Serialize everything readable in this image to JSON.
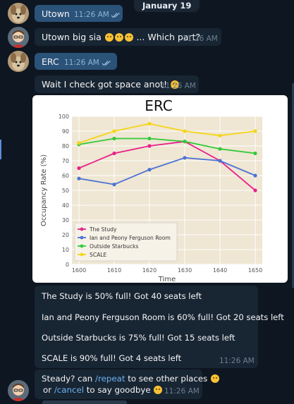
{
  "date_pill": "January 19",
  "messages": [
    {
      "text": "Utown",
      "time": "11:26 AM"
    },
    {
      "text": "Utown big sia",
      "text_after": "... Which part?",
      "time": "11:26 AM"
    },
    {
      "text": "ERC",
      "time": "11:26 AM"
    },
    {
      "text": "Wait I check got space anot!",
      "time": "11:26 AM"
    },
    {
      "lines": [
        "The Study is 50% full!  Got 40 seats left",
        "Ian and Peony Ferguson Room is 60% full!  Got 20 seats left",
        "Outside Starbucks is 75% full!  Got 15 seats left",
        "SCALE is 90% full!  Got 4 seats left"
      ],
      "time": "11:26 AM"
    },
    {
      "line1_a": "Steady? can ",
      "line1_link": "/repeat",
      "line1_b": " to see other places",
      "line2_a": "or ",
      "line2_link": "/cancel",
      "line2_b": " to say goodbye",
      "time": "11:26 AM"
    }
  ],
  "icons": {
    "avatar_user": "dog-avatar-icon",
    "avatar_bot": "bot-avatar-icon",
    "read": "double-check-icon",
    "emoji": "emoji-icon"
  },
  "colors": {
    "bg": "#0e1621",
    "outgoing": "#2b5278",
    "incoming": "#182533",
    "link": "#6ab3f3"
  },
  "chart_data": {
    "type": "line",
    "title": "ERC",
    "xlabel": "Time",
    "ylabel": "Occupancy Rate (%)",
    "x": [
      1600,
      1610,
      1620,
      1630,
      1640,
      1650
    ],
    "xticks": [
      "1600",
      "1610",
      "1620",
      "1630",
      "1640",
      "1650"
    ],
    "yticks": [
      "0",
      "10",
      "20",
      "30",
      "40",
      "50",
      "60",
      "70",
      "80",
      "90",
      "100"
    ],
    "ylim": [
      0,
      100
    ],
    "grid": true,
    "legend": "lower-left",
    "series": [
      {
        "name": "The Study",
        "color": "#e8218a",
        "values": [
          65,
          75,
          80,
          83,
          70,
          50
        ]
      },
      {
        "name": "Ian and Peony Ferguson Room",
        "color": "#4c72d4",
        "values": [
          58,
          54,
          64,
          72,
          70,
          60
        ]
      },
      {
        "name": "Outside Starbucks",
        "color": "#33c93a",
        "values": [
          81,
          85,
          85,
          83,
          78,
          75
        ]
      },
      {
        "name": "SCALE",
        "color": "#f5d516",
        "values": [
          82,
          90,
          95,
          90,
          87,
          90
        ]
      }
    ]
  }
}
